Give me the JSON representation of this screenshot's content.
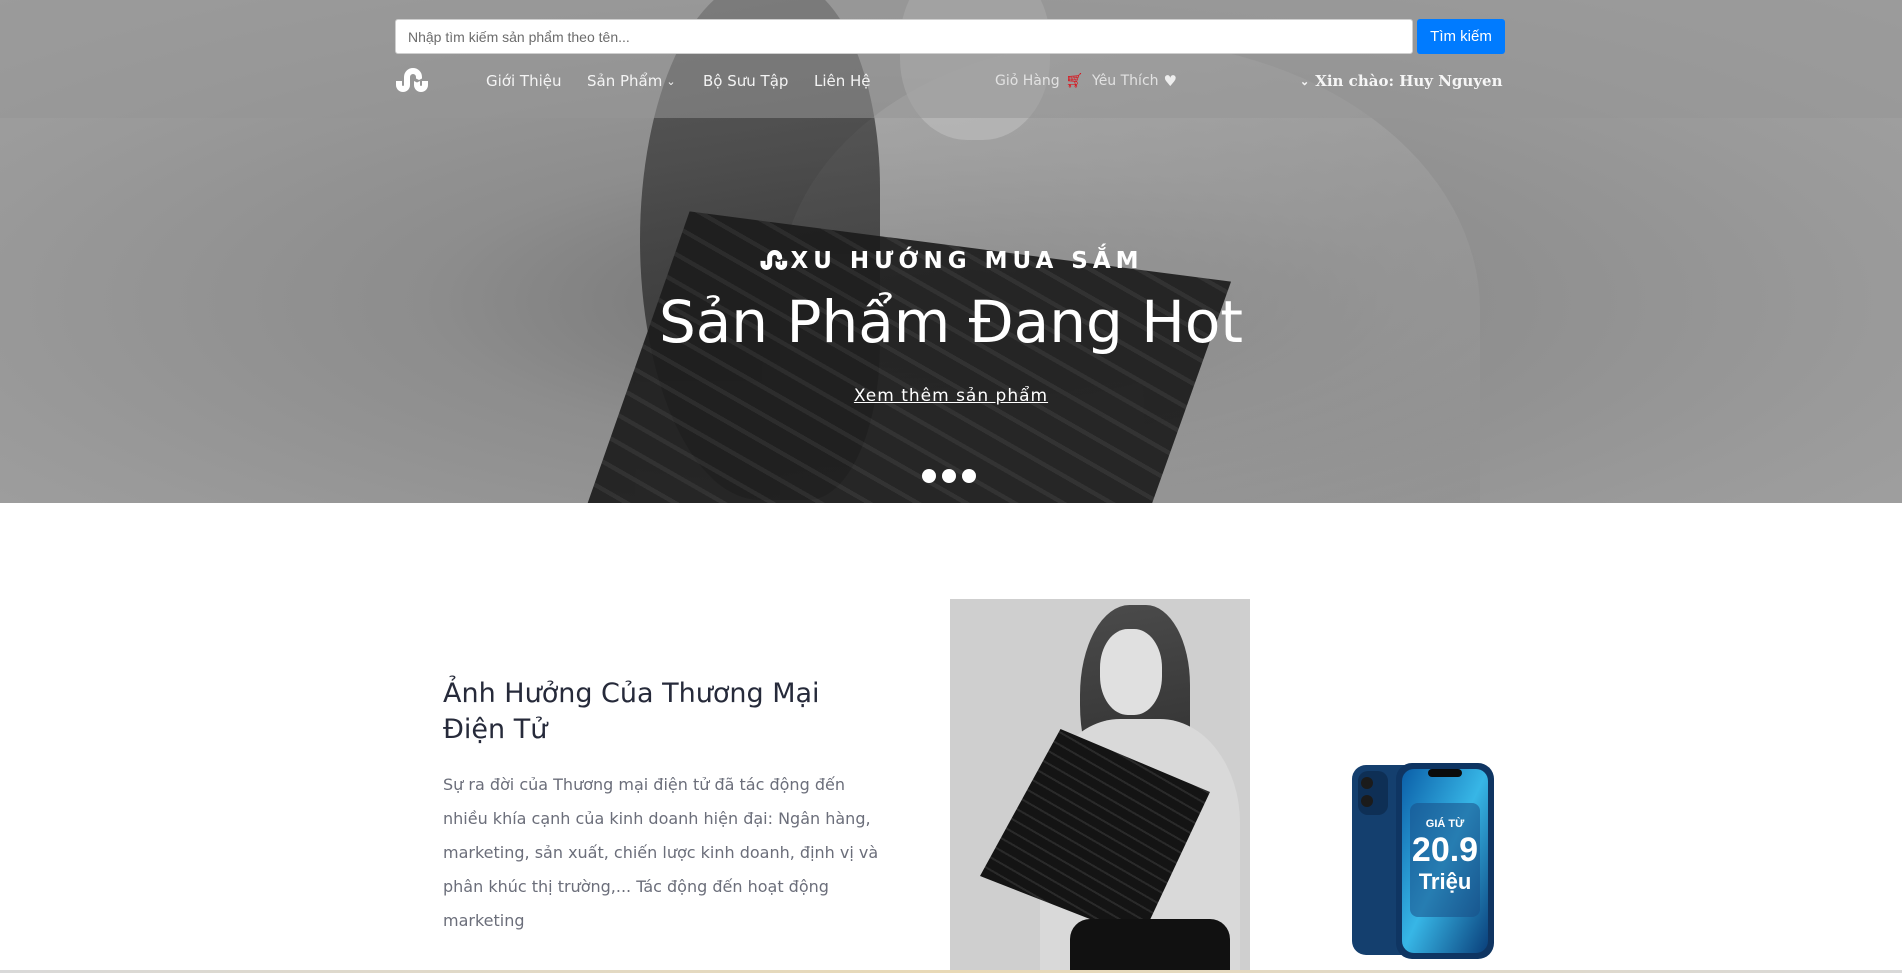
{
  "search": {
    "placeholder": "Nhập tìm kiếm sản phẩm theo tên...",
    "button_label": "Tìm kiếm"
  },
  "nav": {
    "logo_icon": "stumbleupon-icon",
    "items": [
      {
        "label": "Giới Thiệu"
      },
      {
        "label": "Sản Phẩm",
        "has_dropdown": true
      },
      {
        "label": "Bộ Sưu Tập"
      },
      {
        "label": "Liên Hệ"
      }
    ],
    "cart": {
      "label": "Giỏ Hàng",
      "icon": "cart-icon",
      "icon_color": "#e3000b"
    },
    "wishlist": {
      "label": "Yêu Thích",
      "icon": "heart-icon"
    },
    "user_greeting": "Xin chào: Huy Nguyen"
  },
  "hero": {
    "eyebrow": "XU HƯỚNG MUA SẮM",
    "title": "Sản Phẩm Đang Hot",
    "link_label": "Xem thêm sản phẩm",
    "slide_count": 3
  },
  "section": {
    "title": "Ảnh Hưởng Của Thương Mại Điện Tử",
    "text": "Sự ra đời của Thương mại điện tử đã tác động đến nhiều khía cạnh của kinh doanh hiện đại: Ngân hàng, marketing, sản xuất, chiến lược kinh doanh, định vị và phân khúc thị trường,... Tác động đến hoạt động marketing"
  },
  "promo": {
    "price_prefix": "GIÁ TỪ",
    "price_value": "20.9",
    "price_unit": "Triệu"
  },
  "colors": {
    "accent": "#007bff",
    "cart_icon": "#e3000b",
    "heading": "#262a3a",
    "body_text": "#6b6e7a"
  }
}
